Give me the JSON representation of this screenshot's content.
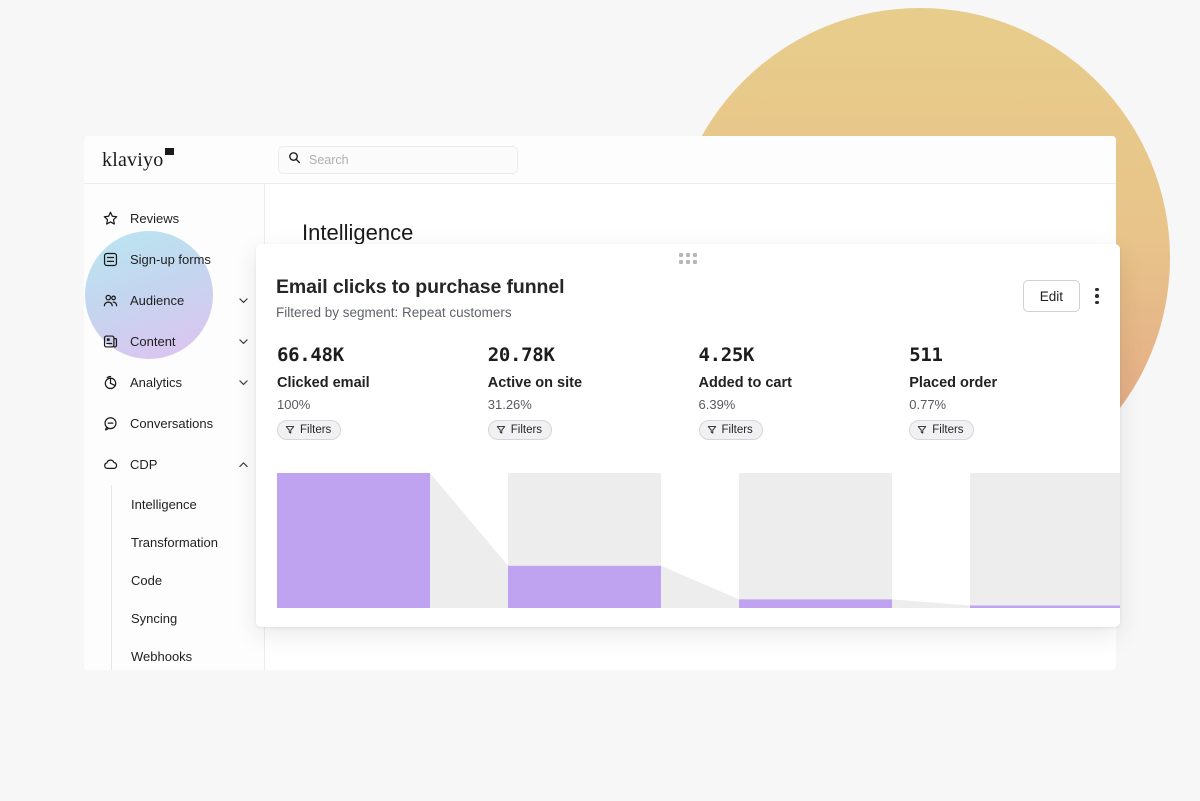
{
  "brand": {
    "logo_text": "klaviyo"
  },
  "search": {
    "placeholder": "Search",
    "value": "",
    "icon": "search-icon"
  },
  "sidebar": {
    "items": [
      {
        "label": "Reviews",
        "icon": "star-icon",
        "expandable": false
      },
      {
        "label": "Sign-up forms",
        "icon": "form-icon",
        "expandable": false
      },
      {
        "label": "Audience",
        "icon": "people-icon",
        "expandable": true,
        "expanded": false
      },
      {
        "label": "Content",
        "icon": "content-icon",
        "expandable": true,
        "expanded": false
      },
      {
        "label": "Analytics",
        "icon": "pie-chart-icon",
        "expandable": true,
        "expanded": false
      },
      {
        "label": "Conversations",
        "icon": "chat-icon",
        "expandable": false
      },
      {
        "label": "CDP",
        "icon": "cloud-icon",
        "expandable": true,
        "expanded": true
      }
    ],
    "cdp_children": [
      {
        "label": "Intelligence"
      },
      {
        "label": "Transformation"
      },
      {
        "label": "Code"
      },
      {
        "label": "Syncing"
      },
      {
        "label": "Webhooks"
      }
    ]
  },
  "page": {
    "title": "Intelligence"
  },
  "card": {
    "title": "Email clicks to purchase funnel",
    "subtitle": "Filtered by segment: Repeat customers",
    "edit_label": "Edit",
    "kebab_label": "More options",
    "drag_handle_label": "Drag handle",
    "filters_label": "Filters"
  },
  "colors": {
    "bar_active": "#bfa3f0",
    "bar_track": "#ededed",
    "connector": "#ededed",
    "card_bg": "#ffffff",
    "page_bg": "#f7f7f7",
    "blob_orange_from": "#e7cd8b",
    "blob_orange_to": "#e2a184",
    "blob_blue_from": "#cbc4ef",
    "blob_blue_to": "#a6e2ee",
    "sidebar_blob_from": "#b9e7f2",
    "sidebar_blob_to": "#dfc2f0"
  },
  "chart_data": {
    "type": "bar",
    "title": "Email clicks to purchase funnel",
    "subtitle": "Filtered by segment: Repeat customers",
    "categories": [
      "Clicked email",
      "Active on site",
      "Added to cart",
      "Placed order"
    ],
    "values": [
      66480,
      20780,
      4250,
      511
    ],
    "value_labels": [
      "66.48K",
      "20.78K",
      "4.25K",
      "511"
    ],
    "percent_labels": [
      "100%",
      "31.26%",
      "6.39%",
      "0.77%"
    ],
    "percents": [
      100,
      31.26,
      6.39,
      0.77
    ],
    "ylabel": "",
    "xlabel": "",
    "ylim": [
      0,
      66480
    ],
    "grid": false,
    "legend": false,
    "funnel": true,
    "bar_fill": "#bfa3f0",
    "track_fill": "#ededed"
  }
}
